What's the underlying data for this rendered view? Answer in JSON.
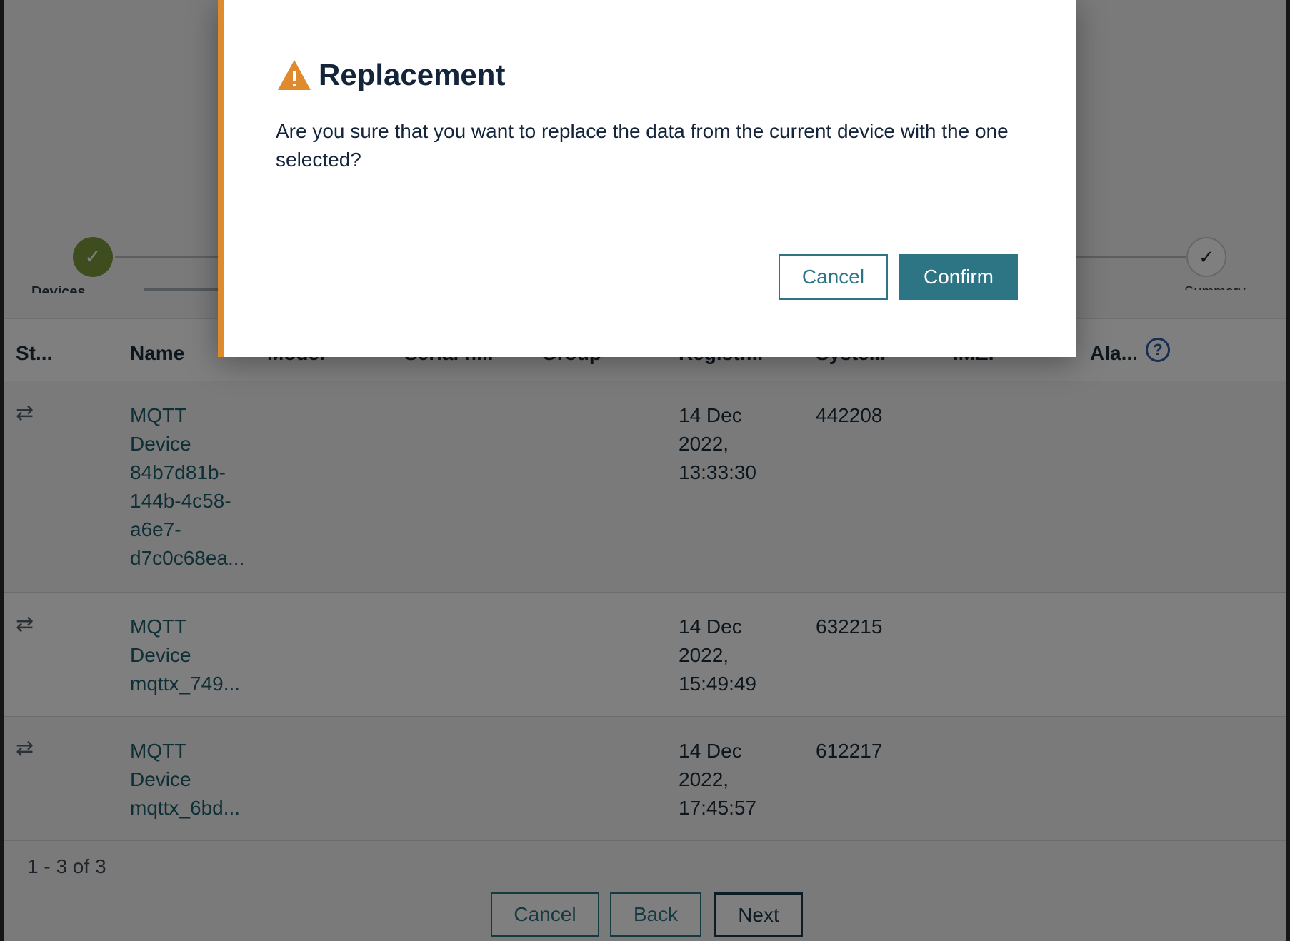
{
  "stepper": {
    "done_icon": "check-icon",
    "final_icon": "check-icon",
    "first_label": "Devices",
    "last_label": "Summary"
  },
  "table": {
    "headers": {
      "status": "St...",
      "name": "Name",
      "model": "Model",
      "serial": "Serial n...",
      "group": "Group",
      "registration": "Registr...",
      "system_id": "Syste...",
      "imei": "IMEI",
      "alarms": "Ala..."
    },
    "rows": [
      {
        "name": "MQTT\nDevice\n84b7d81b-\n144b-4c58-\na6e7-\nd7c0c68ea...",
        "registration": "14 Dec\n2022,\n13:33:30",
        "system_id": "442208"
      },
      {
        "name": "MQTT\nDevice\nmqttx_749...",
        "registration": "14 Dec\n2022,\n15:49:49",
        "system_id": "632215"
      },
      {
        "name": "MQTT\nDevice\nmqttx_6bd...",
        "registration": "14 Dec\n2022,\n17:45:57",
        "system_id": "612217"
      }
    ],
    "pagination": "1 - 3 of 3"
  },
  "footer": {
    "cancel_label": "Cancel",
    "back_label": "Back",
    "next_label": "Next"
  },
  "modal": {
    "title": "Replacement",
    "message": "Are you sure that you want to replace the data from the current device with the one selected?",
    "cancel_label": "Cancel",
    "confirm_label": "Confirm",
    "accent_color": "#e08a2e",
    "primary_color": "#2d7585"
  }
}
